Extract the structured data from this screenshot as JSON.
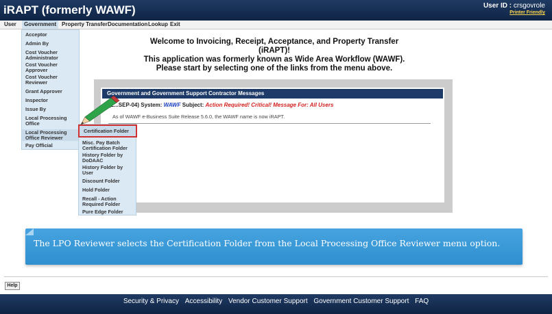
{
  "header": {
    "app_title": "iRAPT (formerly WAWF)",
    "user_label": "User ID :",
    "user_value": "crsgovrole",
    "printer_friendly": "Printer Friendly"
  },
  "menu": {
    "user": "User",
    "government": "Government",
    "property_transfer": "Property Transfer",
    "documentation": "Documentation",
    "lookup": "Lookup",
    "exit": "Exit"
  },
  "gov_dropdown": [
    "Acceptor",
    "Admin By",
    "Cost Voucher Administrator",
    "Cost Voucher Approver",
    "Cost Voucher Reviewer",
    "Grant Approver",
    "Inspector",
    "Issue By",
    "Local Processing Office",
    "Local Processing Office Reviewer",
    "Pay Official"
  ],
  "lpo_submenu": [
    "Certification Folder",
    "Misc. Pay Batch Certification Folder",
    "History Folder by DoDAAC",
    "History Folder by User",
    "Discount Folder",
    "Hold Folder",
    "Recall - Action Required Folder",
    "Pure Edge Folder"
  ],
  "welcome": {
    "line1": "Welcome to Invoicing, Receipt, Acceptance, and Property Transfer (iRAPT)!",
    "line2": "This application was formerly known as Wide Area Workflow (WAWF).",
    "line3": "Please start by selecting one of the links from the menu above."
  },
  "messages": {
    "header": "Government and Government Support Contractor Messages",
    "date_fragment": "(2...SEP-04)",
    "system_label": "System:",
    "system_value": "WAWF",
    "subject_label": "Subject:",
    "subject_value": "Action Required!  Critical!  Message For: All Users",
    "note": "As of WAWF e-Business Suite Release 5.6.0, the WAWF name is now iRAPT."
  },
  "caption": "The LPO Reviewer selects the Certification Folder from the Local Processing Office Reviewer menu option.",
  "help": "Help",
  "footer": {
    "security": "Security & Privacy",
    "accessibility": "Accessibility",
    "vendor": "Vendor Customer Support",
    "government": "Government Customer Support",
    "faq": "FAQ"
  },
  "colors": {
    "header_bg": "#1f3a63",
    "caption_bg": "#3a99d8",
    "highlight_border": "#d03030"
  }
}
